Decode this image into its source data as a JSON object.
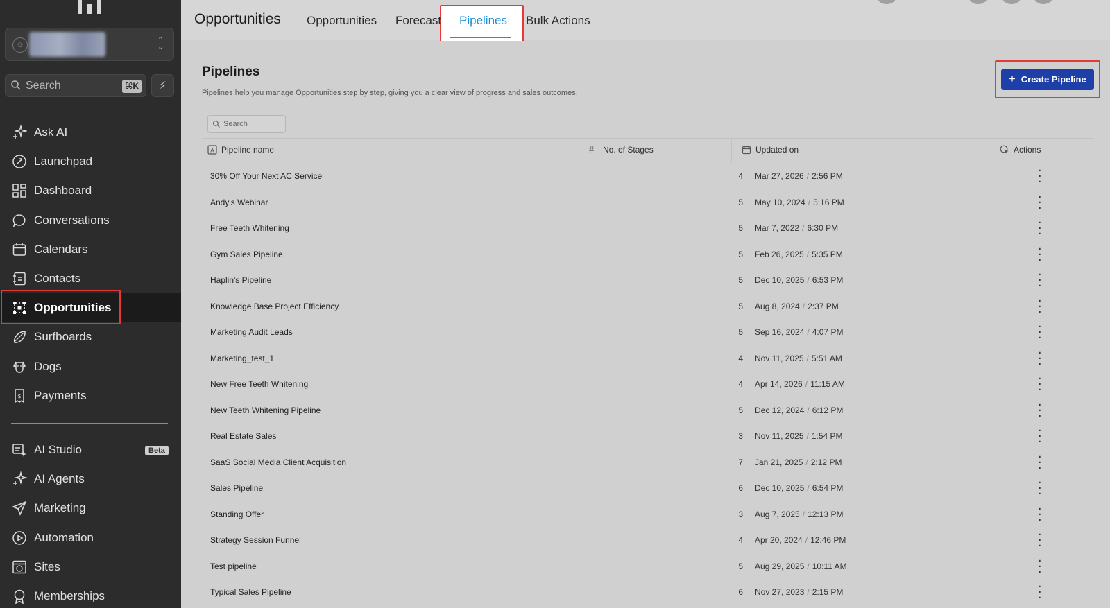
{
  "sidebar": {
    "search": {
      "label": "Search",
      "shortcut": "⌘K"
    },
    "nav": [
      {
        "id": "ask-ai",
        "label": "Ask AI",
        "icon": "sparkle-icon"
      },
      {
        "id": "launchpad",
        "label": "Launchpad",
        "icon": "rocket-icon"
      },
      {
        "id": "dashboard",
        "label": "Dashboard",
        "icon": "grid-icon"
      },
      {
        "id": "conversations",
        "label": "Conversations",
        "icon": "chat-bubble-icon"
      },
      {
        "id": "calendars",
        "label": "Calendars",
        "icon": "calendar-icon"
      },
      {
        "id": "contacts",
        "label": "Contacts",
        "icon": "address-book-icon"
      },
      {
        "id": "opportunities",
        "label": "Opportunities",
        "icon": "nodes-icon",
        "active": true
      },
      {
        "id": "surfboards",
        "label": "Surfboards",
        "icon": "surfboard-icon"
      },
      {
        "id": "dogs",
        "label": "Dogs",
        "icon": "dog-icon"
      },
      {
        "id": "payments",
        "label": "Payments",
        "icon": "receipt-icon"
      }
    ],
    "nav2": [
      {
        "id": "ai-studio",
        "label": "AI Studio",
        "icon": "ai-studio-icon",
        "badge": "Beta"
      },
      {
        "id": "ai-agents",
        "label": "AI Agents",
        "icon": "sparkle-icon"
      },
      {
        "id": "marketing",
        "label": "Marketing",
        "icon": "send-icon"
      },
      {
        "id": "automation",
        "label": "Automation",
        "icon": "play-circle-icon"
      },
      {
        "id": "sites",
        "label": "Sites",
        "icon": "globe-window-icon"
      },
      {
        "id": "memberships",
        "label": "Memberships",
        "icon": "badge-icon"
      }
    ]
  },
  "topbar": {
    "title": "Opportunities",
    "tabs": [
      "Opportunities",
      "Forecast",
      "Pipelines",
      "Bulk Actions"
    ],
    "active_tab": "Pipelines"
  },
  "pipelines": {
    "title": "Pipelines",
    "description": "Pipelines help you manage Opportunities step by step, giving you a clear view of progress and sales outcomes.",
    "create_label": "Create Pipeline",
    "search_placeholder": "Search",
    "columns": {
      "name": "Pipeline name",
      "stages": "No. of Stages",
      "updated": "Updated on",
      "actions": "Actions"
    },
    "rows": [
      {
        "name": "30% Off Your Next AC Service",
        "stages": "4",
        "date": "Mar 27, 2026",
        "time": "2:56 PM"
      },
      {
        "name": "Andy's Webinar",
        "stages": "5",
        "date": "May 10, 2024",
        "time": "5:16 PM"
      },
      {
        "name": "Free Teeth Whitening",
        "stages": "5",
        "date": "Mar 7, 2022",
        "time": "6:30 PM"
      },
      {
        "name": "Gym Sales Pipeline",
        "stages": "5",
        "date": "Feb 26, 2025",
        "time": "5:35 PM"
      },
      {
        "name": "Haplin's Pipeline",
        "stages": "5",
        "date": "Dec 10, 2025",
        "time": "6:53 PM"
      },
      {
        "name": "Knowledge Base Project Efficiency",
        "stages": "5",
        "date": "Aug 8, 2024",
        "time": "2:37 PM"
      },
      {
        "name": "Marketing Audit Leads",
        "stages": "5",
        "date": "Sep 16, 2024",
        "time": "4:07 PM"
      },
      {
        "name": "Marketing_test_1",
        "stages": "4",
        "date": "Nov 11, 2025",
        "time": "5:51 AM"
      },
      {
        "name": "New Free Teeth Whitening",
        "stages": "4",
        "date": "Apr 14, 2026",
        "time": "11:15 AM"
      },
      {
        "name": "New Teeth Whitening Pipeline",
        "stages": "5",
        "date": "Dec 12, 2024",
        "time": "6:12 PM"
      },
      {
        "name": "Real Estate Sales",
        "stages": "3",
        "date": "Nov 11, 2025",
        "time": "1:54 PM"
      },
      {
        "name": "SaaS Social Media Client Acquisition",
        "stages": "7",
        "date": "Jan 21, 2025",
        "time": "2:12 PM"
      },
      {
        "name": "Sales Pipeline",
        "stages": "6",
        "date": "Dec 10, 2025",
        "time": "6:54 PM"
      },
      {
        "name": "Standing Offer",
        "stages": "3",
        "date": "Aug 7, 2025",
        "time": "12:13 PM"
      },
      {
        "name": "Strategy Session Funnel",
        "stages": "4",
        "date": "Apr 20, 2024",
        "time": "12:46 PM"
      },
      {
        "name": "Test pipeline",
        "stages": "5",
        "date": "Aug 29, 2025",
        "time": "10:11 AM"
      },
      {
        "name": "Typical Sales Pipeline",
        "stages": "6",
        "date": "Nov 27, 2023",
        "time": "2:15 PM"
      }
    ]
  },
  "colors": {
    "sidebar_bg": "#2c2c2c",
    "accent_tab": "#1e90d8",
    "primary_button": "#1e3fa8",
    "highlight_box": "#e53935"
  }
}
